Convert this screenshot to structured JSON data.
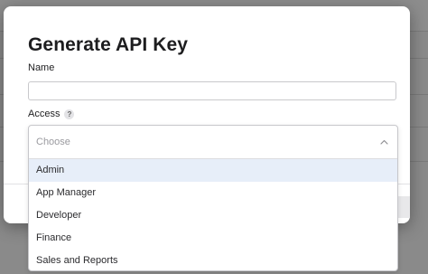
{
  "modal": {
    "title": "Generate API Key",
    "name_label": "Name",
    "name_value": "",
    "access_label": "Access",
    "help_icon": "?"
  },
  "access_select": {
    "placeholder": "Choose",
    "options": [
      {
        "label": "Admin",
        "highlighted": true
      },
      {
        "label": "App Manager",
        "highlighted": false
      },
      {
        "label": "Developer",
        "highlighted": false
      },
      {
        "label": "Finance",
        "highlighted": false
      },
      {
        "label": "Sales and Reports",
        "highlighted": false
      }
    ]
  },
  "icons": {
    "help": "question-icon",
    "expand": "chevron-up-icon"
  },
  "colors": {
    "highlight": "#e7eef9",
    "overlay": "#8a8a8a",
    "modal_bg": "#ffffff"
  }
}
